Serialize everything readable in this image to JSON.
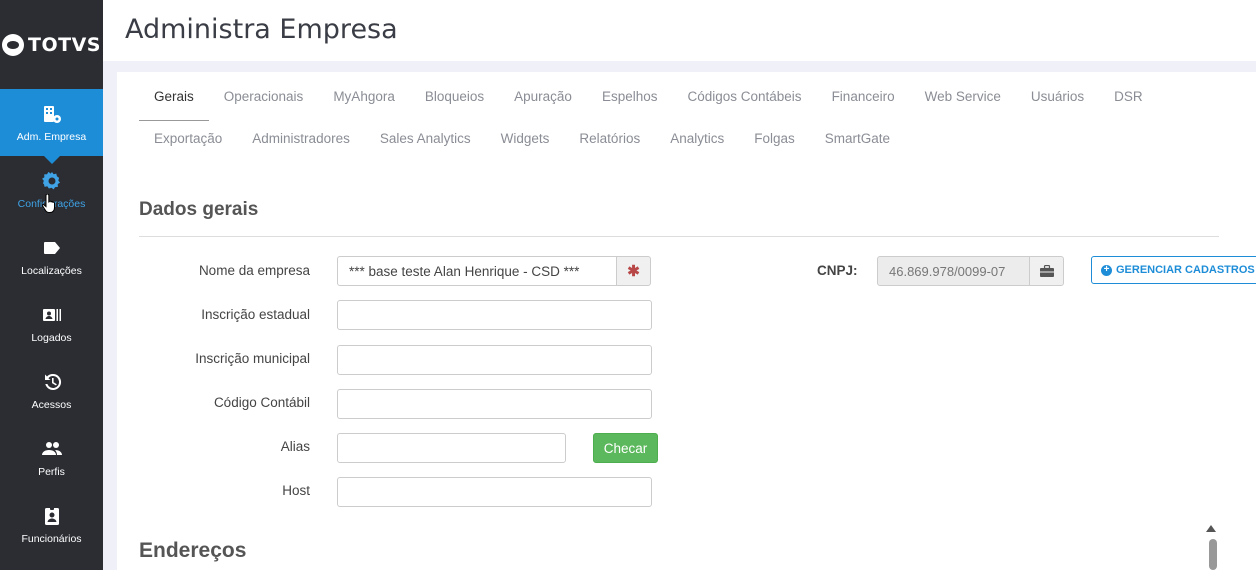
{
  "brand": {
    "logo_text": "TOTVS"
  },
  "sidebar": {
    "items": [
      {
        "label": "Adm. Empresa",
        "icon": "building-gear-icon"
      },
      {
        "label": "Configurações",
        "icon": "gear-icon"
      },
      {
        "label": "Localizações",
        "icon": "tag-icon"
      },
      {
        "label": "Logados",
        "icon": "badge-icon"
      },
      {
        "label": "Acessos",
        "icon": "history-icon"
      },
      {
        "label": "Perfis",
        "icon": "people-icon"
      },
      {
        "label": "Funcionários",
        "icon": "id-card-icon"
      }
    ]
  },
  "header": {
    "title": "Administra Empresa"
  },
  "tabs": {
    "row1": [
      "Gerais",
      "Operacionais",
      "MyAhgora",
      "Bloqueios",
      "Apuração",
      "Espelhos",
      "Códigos Contábeis",
      "Financeiro",
      "Web Service",
      "Usuários",
      "DSR"
    ],
    "row2": [
      "Exportação",
      "Administradores",
      "Sales Analytics",
      "Widgets",
      "Relatórios",
      "Analytics",
      "Folgas",
      "SmartGate"
    ],
    "active": "Gerais"
  },
  "sections": {
    "general": "Dados gerais",
    "addresses": "Endereços"
  },
  "form": {
    "company_name_label": "Nome da empresa",
    "company_name_value": "*** base teste Alan Henrique - CSD ***",
    "state_reg_label": "Inscrição estadual",
    "state_reg_value": "",
    "municipal_reg_label": "Inscrição municipal",
    "municipal_reg_value": "",
    "accounting_code_label": "Código Contábil",
    "accounting_code_value": "",
    "alias_label": "Alias",
    "alias_value": "",
    "check_button": "Checar",
    "host_label": "Host",
    "host_value": "",
    "cnpj_label": "CNPJ:",
    "cnpj_value": "46.869.978/0099-07",
    "manage_button": "GERENCIAR CADASTROS"
  },
  "colors": {
    "sidebar_bg": "#2b2d33",
    "accent": "#1e8dd8",
    "success": "#5cb85c",
    "required": "#b84848"
  }
}
